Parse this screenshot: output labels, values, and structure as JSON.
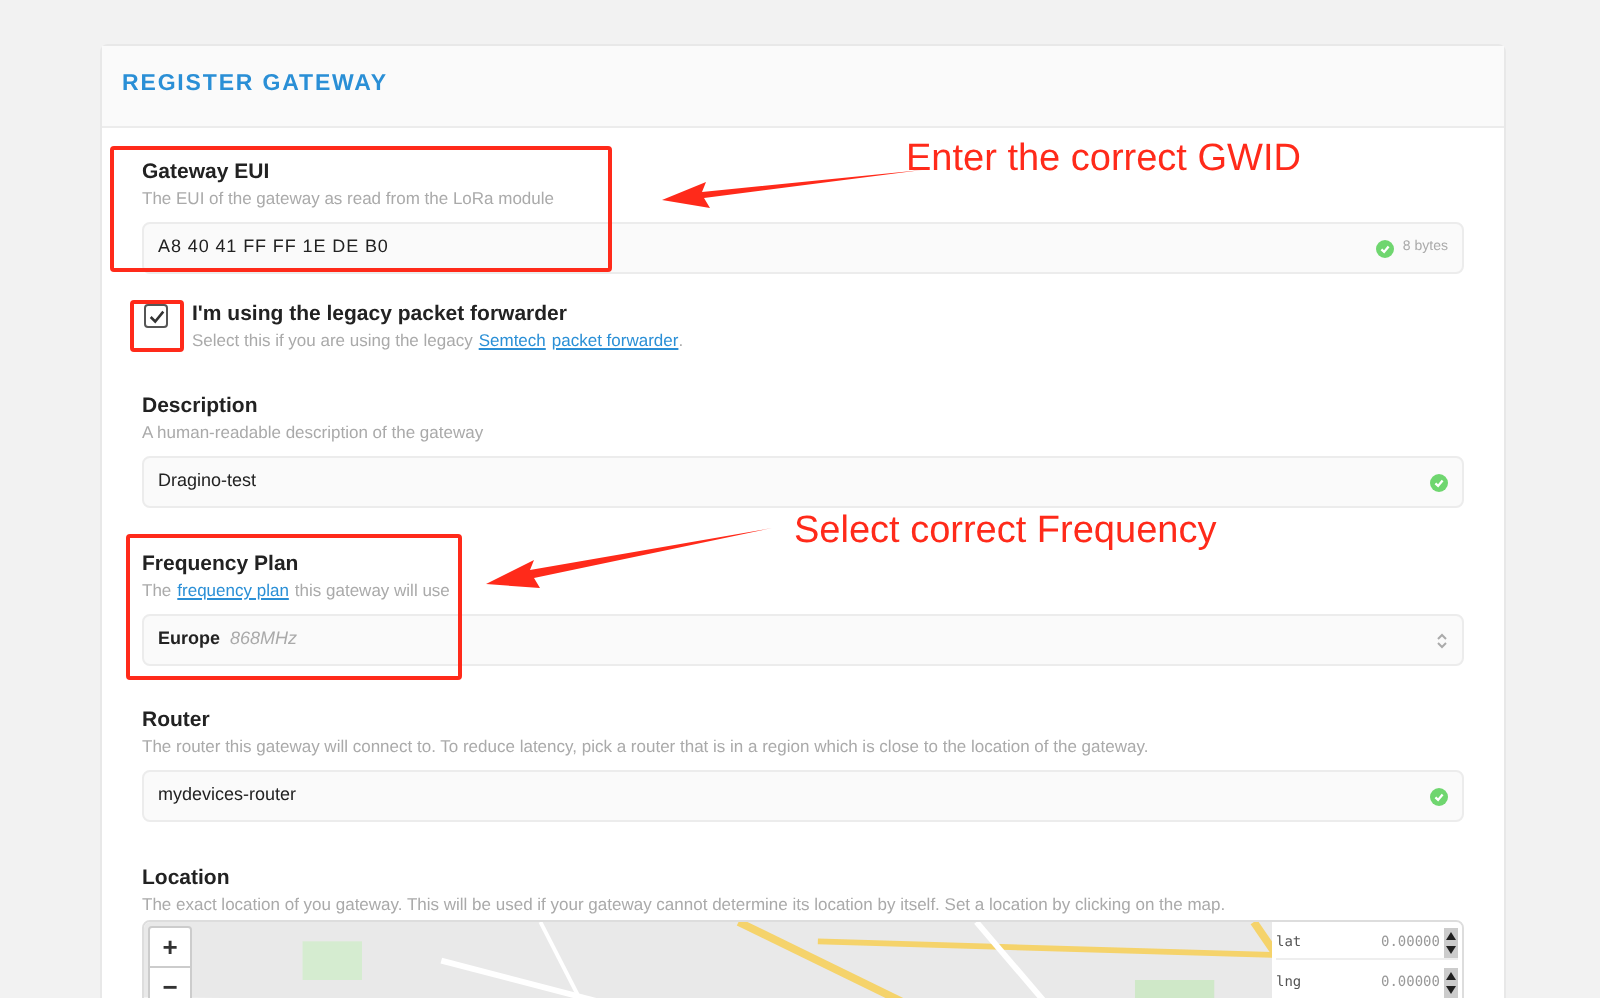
{
  "header": {
    "title": "REGISTER GATEWAY"
  },
  "eui": {
    "label": "Gateway EUI",
    "help": "The EUI of the gateway as read from the LoRa module",
    "value": "A8 40 41 FF FF 1E DE B0",
    "valid": true,
    "badge": "8 bytes"
  },
  "legacy": {
    "label": "I'm using the legacy packet forwarder",
    "checked": true,
    "help_before": "Select this if you are using the legacy",
    "link_1": "Semtech",
    "link_2": "packet forwarder",
    "help_after": "."
  },
  "description": {
    "label": "Description",
    "help": "A human-readable description of the gateway",
    "value": "Dragino-test",
    "valid": true
  },
  "frequency": {
    "label": "Frequency Plan",
    "help_before": "The",
    "link": "frequency plan",
    "help_after": "this gateway will use",
    "value": "Europe",
    "detail": "868MHz"
  },
  "router": {
    "label": "Router",
    "help": "The router this gateway will connect to. To reduce latency, pick a router that is in a region which is close to the location of the gateway.",
    "value": "mydevices-router",
    "valid": true
  },
  "location": {
    "label": "Location",
    "help": "The exact location of you gateway. This will be used if your gateway cannot determine its location by itself. Set a location by clicking on the map.",
    "zoom_in": "+",
    "zoom_out": "−",
    "fields": [
      {
        "label": "lat",
        "value": "0.00000"
      },
      {
        "label": "lng",
        "value": "0.00000"
      }
    ]
  },
  "annotations": [
    {
      "text": "Enter the correct GWID"
    },
    {
      "text": "Select correct Frequency"
    }
  ]
}
